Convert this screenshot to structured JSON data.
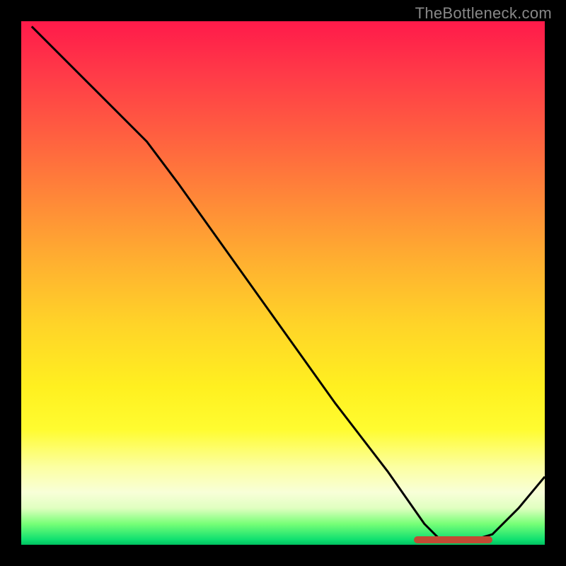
{
  "watermark": "TheBottleneck.com",
  "chart_data": {
    "type": "line",
    "title": "",
    "xlabel": "",
    "ylabel": "",
    "xlim": [
      0,
      100
    ],
    "ylim": [
      0,
      100
    ],
    "gradient_note": "background is a vertical heat gradient from red (top, high bottleneck) through orange/yellow to green (bottom, no bottleneck)",
    "curve": {
      "description": "bottleneck percentage curve descending from top-left to a minimum near x≈85 then rising",
      "points": [
        {
          "x": 2,
          "y": 99
        },
        {
          "x": 14,
          "y": 87
        },
        {
          "x": 24,
          "y": 77
        },
        {
          "x": 30,
          "y": 69
        },
        {
          "x": 40,
          "y": 55
        },
        {
          "x": 50,
          "y": 41
        },
        {
          "x": 60,
          "y": 27
        },
        {
          "x": 70,
          "y": 14
        },
        {
          "x": 77,
          "y": 4
        },
        {
          "x": 80,
          "y": 1
        },
        {
          "x": 85,
          "y": 0.5
        },
        {
          "x": 90,
          "y": 2
        },
        {
          "x": 95,
          "y": 7
        },
        {
          "x": 100,
          "y": 13
        }
      ]
    },
    "recommended_band": {
      "x_start": 75,
      "x_end": 90,
      "y": 1
    }
  }
}
